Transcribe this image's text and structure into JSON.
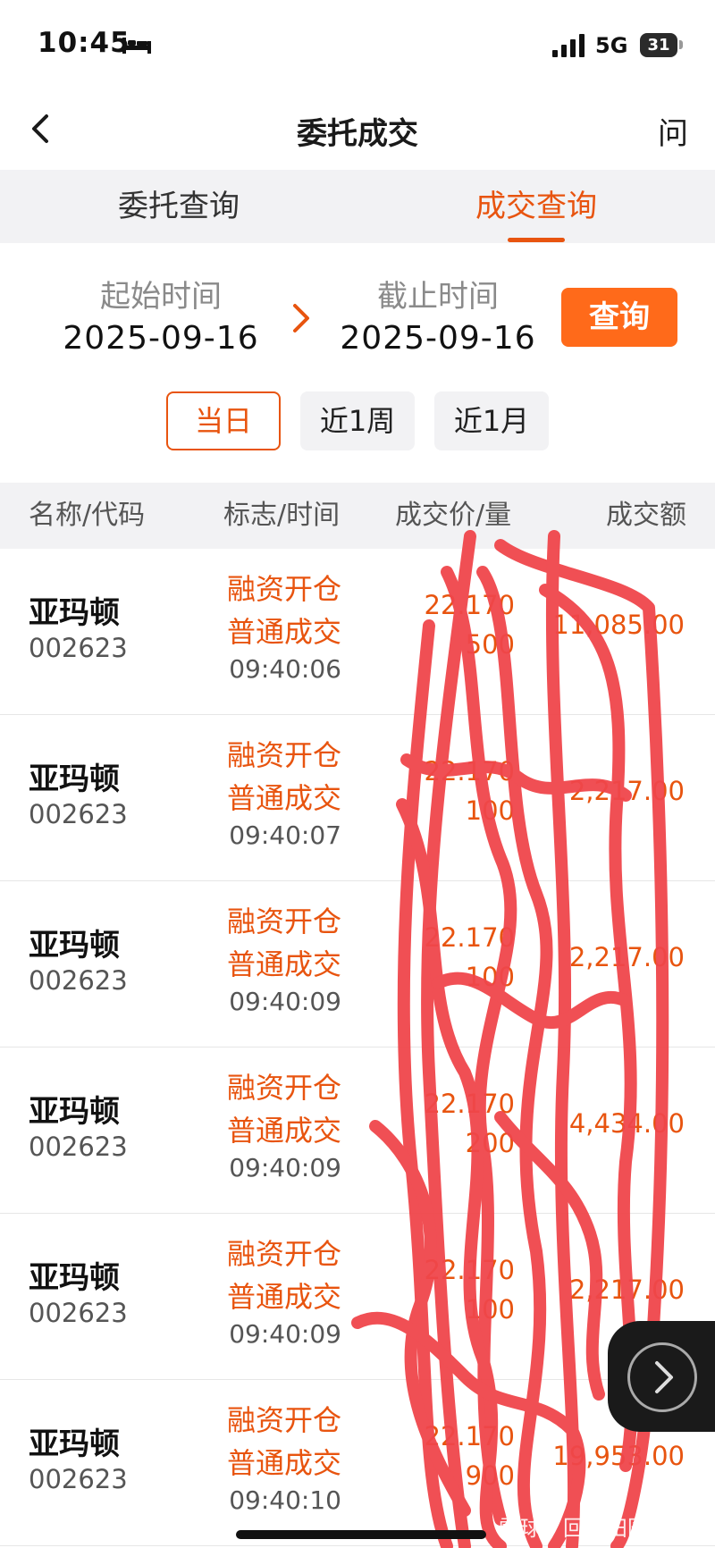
{
  "status": {
    "time": "10:45",
    "network": "5G",
    "battery": "31"
  },
  "nav": {
    "title": "委托成交",
    "help": "问"
  },
  "tabs": [
    {
      "label": "委托查询",
      "active": false
    },
    {
      "label": "成交查询",
      "active": true
    }
  ],
  "date_range": {
    "start_label": "起始时间",
    "start_value": "2025-09-16",
    "end_label": "截止时间",
    "end_value": "2025-09-16",
    "query_label": "查询"
  },
  "quick_filters": {
    "today": "当日",
    "week": "近1周",
    "month": "近1月",
    "selected": "当日"
  },
  "table": {
    "headers": {
      "name": "名称/代码",
      "flag": "标志/时间",
      "price": "成交价/量",
      "amount": "成交额"
    },
    "rows": [
      {
        "name": "亚玛顿",
        "code": "002623",
        "flag": "融资开仓",
        "sub": "普通成交",
        "time": "09:40:06",
        "price": "22.170",
        "qty": "500",
        "amount": "11,085.00"
      },
      {
        "name": "亚玛顿",
        "code": "002623",
        "flag": "融资开仓",
        "sub": "普通成交",
        "time": "09:40:07",
        "price": "22.170",
        "qty": "100",
        "amount": "2,217.00"
      },
      {
        "name": "亚玛顿",
        "code": "002623",
        "flag": "融资开仓",
        "sub": "普通成交",
        "time": "09:40:09",
        "price": "22.170",
        "qty": "100",
        "amount": "2,217.00"
      },
      {
        "name": "亚玛顿",
        "code": "002623",
        "flag": "融资开仓",
        "sub": "普通成交",
        "time": "09:40:09",
        "price": "22.170",
        "qty": "200",
        "amount": "4,434.00"
      },
      {
        "name": "亚玛顿",
        "code": "002623",
        "flag": "融资开仓",
        "sub": "普通成交",
        "time": "09:40:09",
        "price": "22.170",
        "qty": "100",
        "amount": "2,217.00"
      },
      {
        "name": "亚玛顿",
        "code": "002623",
        "flag": "融资开仓",
        "sub": "普通成交",
        "time": "09:40:10",
        "price": "22.170",
        "qty": "900",
        "amount": "19,953.00"
      }
    ]
  },
  "watermark": "雪球：回归田园wl",
  "colors": {
    "accent": "#e8540f",
    "button": "#ff6a1a",
    "scribble": "#f0464b"
  }
}
